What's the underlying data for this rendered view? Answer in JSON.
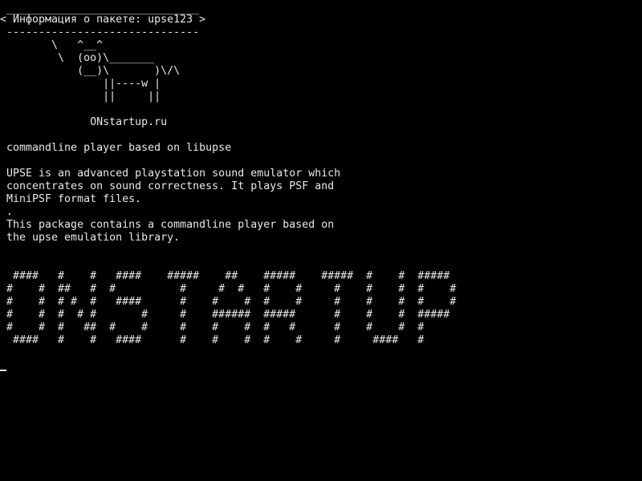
{
  "terminal": {
    "cowsay_top_border": " ______________________________",
    "cowsay_message": "< Информация о пакете: upse123 >",
    "cowsay_bottom_border": " ------------------------------",
    "cow_art": [
      "        \\   ^__^",
      "         \\  (oo)\\_______",
      "            (__)\\       )\\/\\",
      "                ||----w |",
      "                ||     ||"
    ],
    "site_label": "              ONstartup.ru",
    "package_summary": " commandline player based on libupse",
    "description": [
      " UPSE is an advanced playstation sound emulator which",
      " concentrates on sound correctness. It plays PSF and",
      " MiniPSF format files.",
      " .",
      " This package contains a commandline player based on",
      " the upse emulation library."
    ],
    "banner": [
      "  ####   #    #   ####    #####    ##    #####    #####  #    #  #####",
      " #    #  ##   #  #          #     #  #   #    #     #    #    #  #    #",
      " #    #  # #  #   ####      #    #    #  #    #     #    #    #  #    #",
      " #    #  #  # #       #     #    ######  #####      #    #    #  #####",
      " #    #  #   ##  #    #     #    #    #  #   #      #    #    #  #",
      "  ####   #    #   ####      #    #    #  #    #     #     ####   #"
    ]
  }
}
